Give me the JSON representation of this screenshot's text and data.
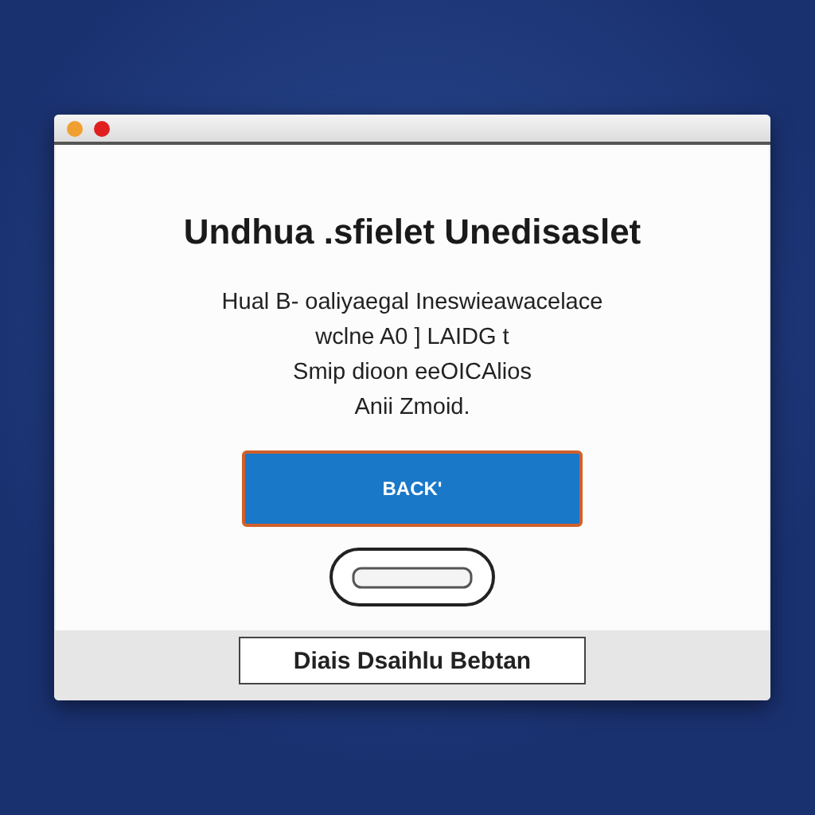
{
  "window": {
    "controls": [
      {
        "color": "#f0a030"
      },
      {
        "color": "#e02020"
      }
    ]
  },
  "dialog": {
    "title": "Undhua .sfielet Unedisaslet",
    "message": [
      "Hual B- oaliyaegal Ineswieawacelace",
      "wclne A0 ] LAIDG t",
      "Smip dioon eeOICAlios",
      "Anii Zmoid."
    ],
    "primary_button": "BACK'"
  },
  "footer": {
    "label": "Diais Dsaihlu Bebtan"
  }
}
